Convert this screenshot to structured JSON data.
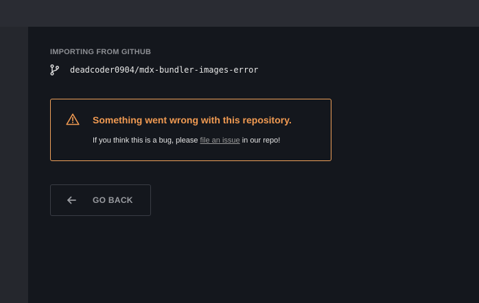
{
  "header": {
    "import_label": "IMPORTING FROM GITHUB",
    "repo_name": "deadcoder0904/mdx-bundler-images-error",
    "repo_icon": "git-branch-icon"
  },
  "error": {
    "icon": "warning-triangle-icon",
    "title": "Something went wrong with this repository.",
    "desc_prefix": "If you think this is a bug, please ",
    "desc_link": "file an issue",
    "desc_suffix": " in our repo!",
    "accent_color": "#f09a52"
  },
  "actions": {
    "back_icon": "arrow-left-icon",
    "back_label": "GO BACK"
  }
}
